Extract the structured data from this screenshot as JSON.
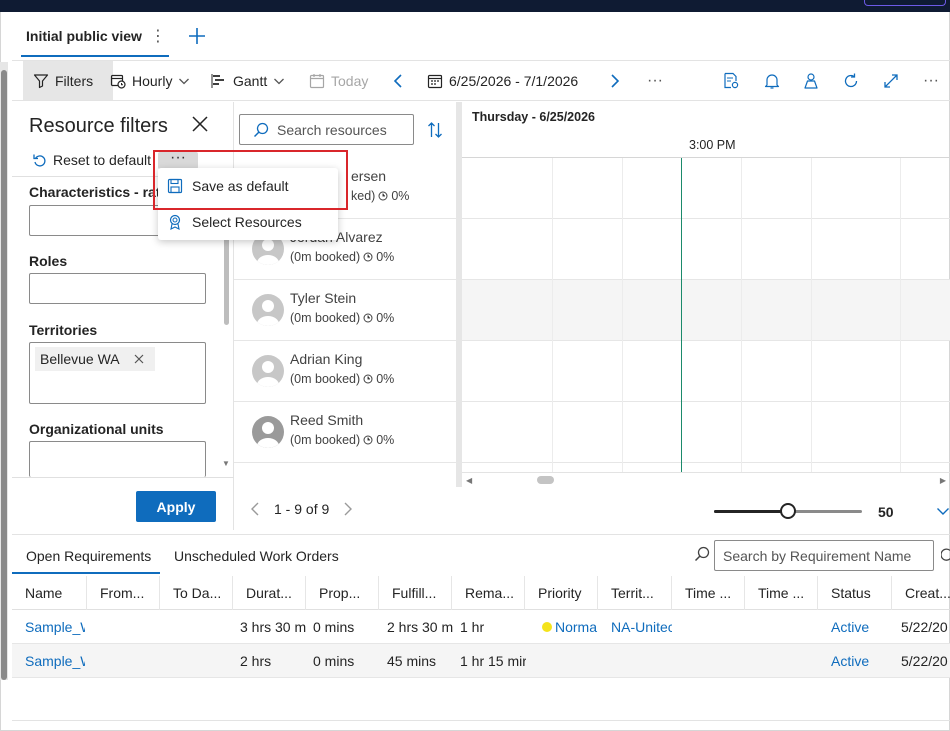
{
  "view": {
    "tab_label": "Initial public view",
    "more_icon": "more-vertical-icon",
    "add_icon": "plus-icon"
  },
  "toolbar": {
    "filters": "Filters",
    "hourly": "Hourly",
    "gantt": "Gantt",
    "today": "Today",
    "date_range": "6/25/2026 - 7/1/2026",
    "more": "···"
  },
  "filter_panel": {
    "title": "Resource filters",
    "reset": "Reset to default",
    "more": "···",
    "characteristics_label": "Characteristics - rati",
    "roles_label": "Roles",
    "territories_label": "Territories",
    "territory_chip": "Bellevue WA",
    "org_units_label": "Organizational units",
    "apply": "Apply"
  },
  "menu": {
    "items": [
      {
        "label": "Save as default",
        "icon": "save-icon"
      },
      {
        "label": "Select Resources",
        "icon": "ribbon-icon"
      }
    ]
  },
  "resources": {
    "search_placeholder": "Search resources",
    "rows": [
      {
        "name": "ersen",
        "booked": "ked)",
        "pct": "0%"
      },
      {
        "name": "Jordan Alvarez",
        "booked": "(0m booked)",
        "pct": "0%"
      },
      {
        "name": "Tyler Stein",
        "booked": "(0m booked)",
        "pct": "0%"
      },
      {
        "name": "Adrian King",
        "booked": "(0m booked)",
        "pct": "0%"
      },
      {
        "name": "Reed Smith",
        "booked": "(0m booked)",
        "pct": "0%"
      }
    ]
  },
  "timeline": {
    "day_label": "Thursday - 6/25/2026",
    "time_label": "3:00 PM"
  },
  "pager": {
    "text": "1 - 9 of 9",
    "zoom": "50",
    "zoom_fraction": 0.5
  },
  "bottom": {
    "tabs": [
      "Open Requirements",
      "Unscheduled Work Orders"
    ],
    "search_placeholder": "Search by Requirement Name",
    "columns": [
      "Name",
      "From...",
      "To Da...",
      "Durat...",
      "Prop...",
      "Fulfill...",
      "Rema...",
      "Priority",
      "Territ...",
      "Time ...",
      "Time ...",
      "Status",
      "Creat..."
    ],
    "rows": [
      {
        "name": "Sample_W",
        "duration": "3 hrs 30 m",
        "proposed": "0 mins",
        "fulfilled": "2 hrs 30 m",
        "remaining": "1 hr",
        "priority": "Norma",
        "territory": "NA-Unitec",
        "status": "Active",
        "created": "5/22/20"
      },
      {
        "name": "Sample_W",
        "duration": "2 hrs",
        "proposed": "0 mins",
        "fulfilled": "45 mins",
        "remaining": "1 hr 15 mir",
        "priority": "",
        "territory": "",
        "status": "Active",
        "created": "5/22/20"
      }
    ]
  },
  "colors": {
    "accent": "#0f6cbd",
    "highlight": "#d9262b",
    "now_line": "#1b8a6b",
    "priority_normal": "#f4e31b"
  }
}
